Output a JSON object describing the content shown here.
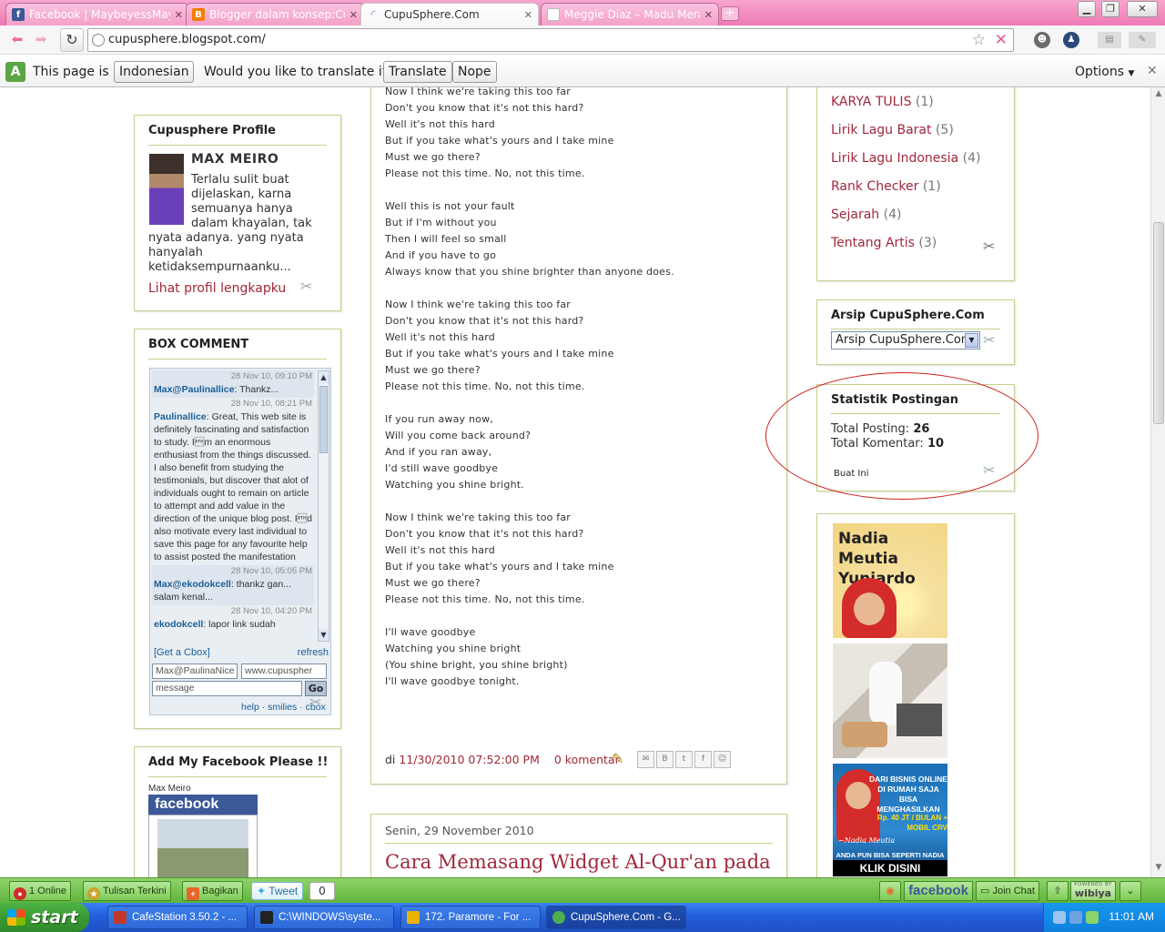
{
  "browser": {
    "tabs": [
      {
        "title": "Facebook | MaybeyessMay...",
        "fav": "f",
        "fav_color": "#3b5998"
      },
      {
        "title": "Blogger dalam konsep:Cup...",
        "fav": "B",
        "fav_color": "#f57d00"
      },
      {
        "title": "CupuSphere.Com",
        "fav": "",
        "fav_color": "#ffffff"
      },
      {
        "title": "Meggie Diaz – Madu Merah ...",
        "fav": "",
        "fav_color": "#ffffff"
      }
    ],
    "url": "cupusphere.blogspot.com/"
  },
  "translate_bar": {
    "prefix": "This page is in",
    "language": "Indonesian",
    "question": "Would you like to translate it?",
    "translate_label": "Translate",
    "nope_label": "Nope",
    "options_label": "Options"
  },
  "profile": {
    "title": "Cupusphere Profile",
    "name": "MAX MEIRO",
    "desc_lines": [
      "Terlalu sulit buat",
      "dijelaskan, karna",
      "semuanya hanya",
      "dalam khayalan, tak",
      "nyata adanya. yang nyata",
      "hanyalah",
      "ketidaksempurnaanku..."
    ],
    "link": "Lihat profil lengkapku"
  },
  "box_comment": {
    "title": "BOX COMMENT",
    "messages": [
      {
        "time": "28 Nov 10, 09:10 PM",
        "author": "Max@Paulinallice",
        "text": ": Thankz..."
      },
      {
        "time": "28 Nov 10, 08:21 PM",
        "author": "Paulinallice",
        "text": ": Great, This web site is definitely fascinating and satisfaction to study. I\u0002m an enormous enthusiast from the things discussed. I also benefit from studying the testimonials, but discover that alot of individuals ought to remain on article to attempt and add value in the direction of the unique blog post. I\u0002d also motivate every last individual to save this page for any favourite help to assist posted the manifestation"
      },
      {
        "time": "28 Nov 10, 05:05 PM",
        "author": "Max@ekodokcell",
        "text": ": thankz gan... salam kenal..."
      },
      {
        "time": "28 Nov 10, 04:20 PM",
        "author": "ekodokcell",
        "text": ": lapor link sudah"
      }
    ],
    "get_cbox": "[Get a Cbox]",
    "refresh": "refresh",
    "name_value": "Max@PaulinaNice",
    "url_value": "www.cupuspher",
    "message_placeholder": "message",
    "go_label": "Go",
    "footer": "help · smilies · cbox"
  },
  "facebook_widget": {
    "title": "Add My Facebook Please !!",
    "name": "Max Meiro",
    "brand": "facebook"
  },
  "post": {
    "lyrics": [
      "Now I think we're taking this too far",
      "Don't you know that it's not this hard?",
      "Well it's not this hard",
      "But if you take what's yours and I take mine",
      "Must we go there?",
      "Please not this time. No, not this time.",
      "",
      "Well this is not your fault",
      "But if I'm without you",
      "Then I will feel so small",
      "And if you have to go",
      "Always know that you shine brighter than anyone does.",
      "",
      "Now I think we're taking this too far",
      "Don't you know that it's not this hard?",
      "Well it's not this hard",
      "But if you take what's yours and I take mine",
      "Must we go there?",
      "Please not this time. No, not this time.",
      "",
      "If you run away now,",
      "Will you come back around?",
      "And if you ran away,",
      "I'd still wave goodbye",
      "Watching you shine bright.",
      "",
      "Now I think we're taking this too far",
      "Don't you know that it's not this hard?",
      "Well it's not this hard",
      "But if you take what's yours and I take mine",
      "Must we go there?",
      "Please not this time. No, not this time.",
      "",
      "I'll wave goodbye",
      "Watching you shine bright",
      "(You shine bright, you shine bright)",
      "I'll wave goodbye tonight."
    ],
    "footer_prefix": "di",
    "timestamp": "11/30/2010 07:52:00 PM",
    "comments": "0 komentar"
  },
  "next_post": {
    "date": "Senin, 29 November 2010",
    "title": "Cara Memasang Widget Al-Qur'an pada"
  },
  "labels": [
    {
      "name": "KARYA TULIS",
      "count": "(1)"
    },
    {
      "name": "Lirik Lagu Barat",
      "count": "(5)"
    },
    {
      "name": "Lirik Lagu Indonesia",
      "count": "(4)"
    },
    {
      "name": "Rank Checker",
      "count": "(1)"
    },
    {
      "name": "Sejarah",
      "count": "(4)"
    },
    {
      "name": "Tentang Artis",
      "count": "(3)"
    }
  ],
  "archive": {
    "title": "Arsip CupuSphere.Com",
    "selected": "Arsip CupuSphere.Com"
  },
  "stats": {
    "title": "Statistik Postingan",
    "posts_label": "Total Posting:",
    "posts_value": "26",
    "comments_label": "Total Komentar:",
    "comments_value": "10",
    "make_link": "Buat Ini"
  },
  "ads": {
    "ad1_title_line1": "Nadia Meutia",
    "ad1_title_line2": "Yuniardo",
    "ad3_line1": "DARI BISNIS ONLINE DI RUMAH SAJA BISA MENGHASILKAN",
    "ad3_line2": "Rp. 40 JT / BULAN + MOBIL CRV",
    "ad3_sig": "~Nadia Meutia",
    "ad3_line3": "ANDA PUN BISA SEPERTI NADIA",
    "ad3_cta": "KLIK DISINI"
  },
  "wibiya": {
    "online": "1 Online",
    "recent": "Tulisan Terkini",
    "share": "Bagikan",
    "tweet": "Tweet",
    "tweet_count": "0",
    "facebook": "facebook",
    "chat": "Join Chat",
    "powered": "POWERED BY",
    "brand": "wibiya"
  },
  "taskbar": {
    "start": "start",
    "tasks": [
      {
        "label": "CafeStation 3.50.2 - ...",
        "color": "#c0392b"
      },
      {
        "label": "C:\\WINDOWS\\syste...",
        "color": "#222222"
      },
      {
        "label": "172. Paramore - For ...",
        "color": "#e8b400"
      },
      {
        "label": "CupuSphere.Com - G...",
        "color": "#4caf50"
      }
    ],
    "clock": "11:01 AM"
  }
}
